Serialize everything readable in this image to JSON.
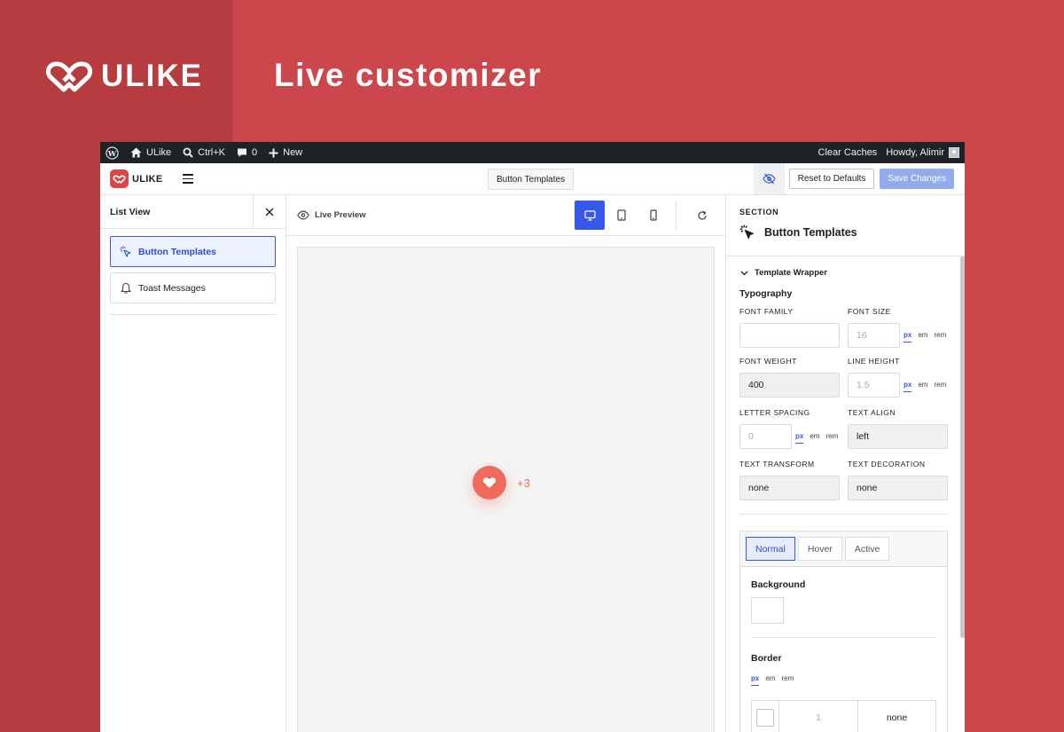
{
  "brand": {
    "name": "ULIKE",
    "tagline": "Live customizer"
  },
  "adminbar": {
    "site_name": "ULike",
    "search_shortcut": "Ctrl+K",
    "comments_count": "0",
    "new_label": "New",
    "clear_caches": "Clear Caches",
    "howdy": "Howdy, Alimir"
  },
  "header": {
    "logo_text": "ULIKE",
    "center_label": "Button Templates",
    "reset_label": "Reset to Defaults",
    "save_label": "Save Changes"
  },
  "list_view": {
    "title": "List View",
    "items": [
      {
        "label": "Button Templates",
        "active": true
      },
      {
        "label": "Toast Messages",
        "active": false
      }
    ]
  },
  "preview": {
    "label": "Live Preview",
    "like_count": "+3"
  },
  "section": {
    "kicker": "SECTION",
    "title": "Button Templates",
    "group_title": "Template Wrapper",
    "typography_title": "Typography",
    "fields": {
      "font_family": {
        "label": "FONT FAMILY",
        "value": ""
      },
      "font_size": {
        "label": "FONT SIZE",
        "placeholder": "16"
      },
      "font_weight": {
        "label": "FONT WEIGHT",
        "value": "400"
      },
      "line_height": {
        "label": "LINE HEIGHT",
        "placeholder": "1.5"
      },
      "letter_spacing": {
        "label": "LETTER SPACING",
        "placeholder": "0"
      },
      "text_align": {
        "label": "TEXT ALIGN",
        "value": "left"
      },
      "text_transform": {
        "label": "TEXT TRANSFORM",
        "value": "none"
      },
      "text_decoration": {
        "label": "TEXT DECORATION",
        "value": "none"
      }
    },
    "units": [
      "px",
      "em",
      "rem"
    ],
    "state_tabs": [
      "Normal",
      "Hover",
      "Active"
    ],
    "background_label": "Background",
    "border_label": "Border",
    "border_width_placeholder": "1",
    "border_style_value": "none"
  },
  "colors": {
    "brand_red": "#cc474b",
    "accent_blue": "#3858e9",
    "like_coral": "#f0695a"
  }
}
